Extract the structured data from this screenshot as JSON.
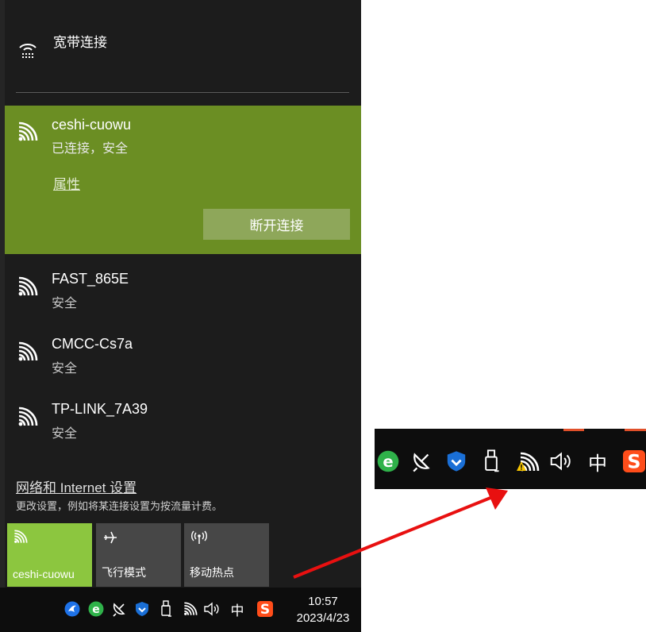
{
  "flyout": {
    "broadband": {
      "label": "宽带连接",
      "icon": "ethernet-dialup-icon"
    },
    "connected": {
      "name": "ceshi-cuowu",
      "status": "已连接，安全",
      "properties_link": "属性",
      "disconnect_label": "断开连接",
      "icon": "wifi-icon"
    },
    "networks": [
      {
        "name": "FAST_865E",
        "status": "安全",
        "icon": "wifi-icon"
      },
      {
        "name": "CMCC-Cs7a",
        "status": "安全",
        "icon": "wifi-icon"
      },
      {
        "name": "TP-LINK_7A39",
        "status": "安全",
        "icon": "wifi-icon"
      }
    ],
    "settings": {
      "link": "网络和 Internet 设置",
      "description": "更改设置，例如将某连接设置为按流量计费。"
    },
    "quick_actions": [
      {
        "label": "ceshi-cuowu",
        "icon": "wifi-icon",
        "active": true
      },
      {
        "label": "飞行模式",
        "icon": "airplane-icon",
        "active": false
      },
      {
        "label": "移动热点",
        "icon": "hotspot-icon",
        "active": false
      }
    ]
  },
  "taskbar": {
    "ime": "中",
    "time": "10:57",
    "date": "2023/4/23",
    "icons": [
      "swift-icon",
      "ie-icon",
      "satellite-icon",
      "shield-icon",
      "usb-icon",
      "wifi-icon",
      "volume-icon",
      "ime-icon",
      "sogou-icon"
    ]
  },
  "zoom_inset": {
    "ime": "中",
    "icons": [
      "ie-icon",
      "satellite-icon",
      "shield-icon",
      "usb-icon",
      "wifi-warning-icon",
      "volume-icon",
      "ime-icon",
      "sogou-icon"
    ]
  },
  "colors": {
    "connected_bg": "#6b8e23",
    "active_tile": "#8cc63f",
    "panel_bg": "#1c1c1c",
    "arrow": "#e81010",
    "warning": "#f5c400"
  }
}
